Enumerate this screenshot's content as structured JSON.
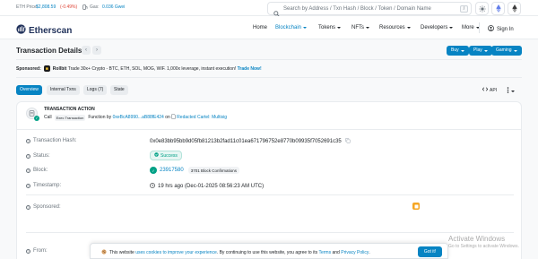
{
  "topbar": {
    "eth_price_label": "ETH Price:",
    "eth_price": "$2,808.59",
    "eth_change": "(-0.49%)",
    "gas_label": "Gas:",
    "gas_value": "0.036 Gwei",
    "search_placeholder": "Search by Address / Txn Hash / Block / Token / Domain Name",
    "search_kbd": "/"
  },
  "nav": {
    "logo_text": "Etherscan",
    "items": [
      {
        "label": "Home"
      },
      {
        "label": "Blockchain"
      },
      {
        "label": "Tokens"
      },
      {
        "label": "NFTs"
      },
      {
        "label": "Resources"
      },
      {
        "label": "Developers"
      },
      {
        "label": "More"
      }
    ],
    "signin_label": "Sign In"
  },
  "page": {
    "title": "Transaction Details",
    "prev_label": "‹",
    "next_label": "›",
    "actions": [
      {
        "label": "Buy"
      },
      {
        "label": "Play"
      },
      {
        "label": "Gaming"
      }
    ]
  },
  "sponsored": {
    "label": "Sponsored:",
    "brand": "Bolt:",
    "brand_name": "Rollbit",
    "text": "Trade 30x+ Crypto - BTC, ETH, SOL, MOG, WIF. 1,000x leverage, instant execution!",
    "cta": "Trade Now!"
  },
  "tabs": [
    {
      "label": "Overview"
    },
    {
      "label": "Internal Txns"
    },
    {
      "label": "Logs (7)"
    },
    {
      "label": "State"
    }
  ],
  "tools": {
    "api_label": "API",
    "more_label": ""
  },
  "tx_action": {
    "title": "TRANSACTION ACTION",
    "call_label": "Call",
    "method": "Exec Transaction",
    "function_by": "Function by",
    "from_address": "0xeBcA8990...aB88fE424",
    "on_label": "on",
    "contract": "Redacted Cartel: Multisig"
  },
  "details": {
    "hash_label": "Transaction Hash:",
    "hash_value": "0x0e83bb95bb9d05fb81213b2fad11c01ea671796752e8770b09935f7052691c35",
    "status_label": "Status:",
    "status_value": "Success",
    "block_label": "Block:",
    "block_value": "23917580",
    "confirmations": "3701 Block Confirmations",
    "timestamp_label": "Timestamp:",
    "timestamp_value": "19 hrs ago (Dec-01-2025 08:56:23 AM UTC)",
    "sponsored_label": "Sponsored:",
    "from_label": "From:"
  },
  "cookie": {
    "lead": "This website",
    "link1": "uses cookies to improve your experience",
    "mid": ". By continuing to use this website, you agree to its",
    "link2": "Terms",
    "and": "and",
    "link3": "Privacy Policy",
    "end": ".",
    "button": "Got it!"
  },
  "watermark": {
    "line1": "Activate Windows",
    "line2": "Go to Settings to activate Windows."
  },
  "colors": {
    "accent": "#0784c3",
    "success": "#00a186",
    "negative": "#de4437",
    "brand_dark": "#21325b"
  }
}
